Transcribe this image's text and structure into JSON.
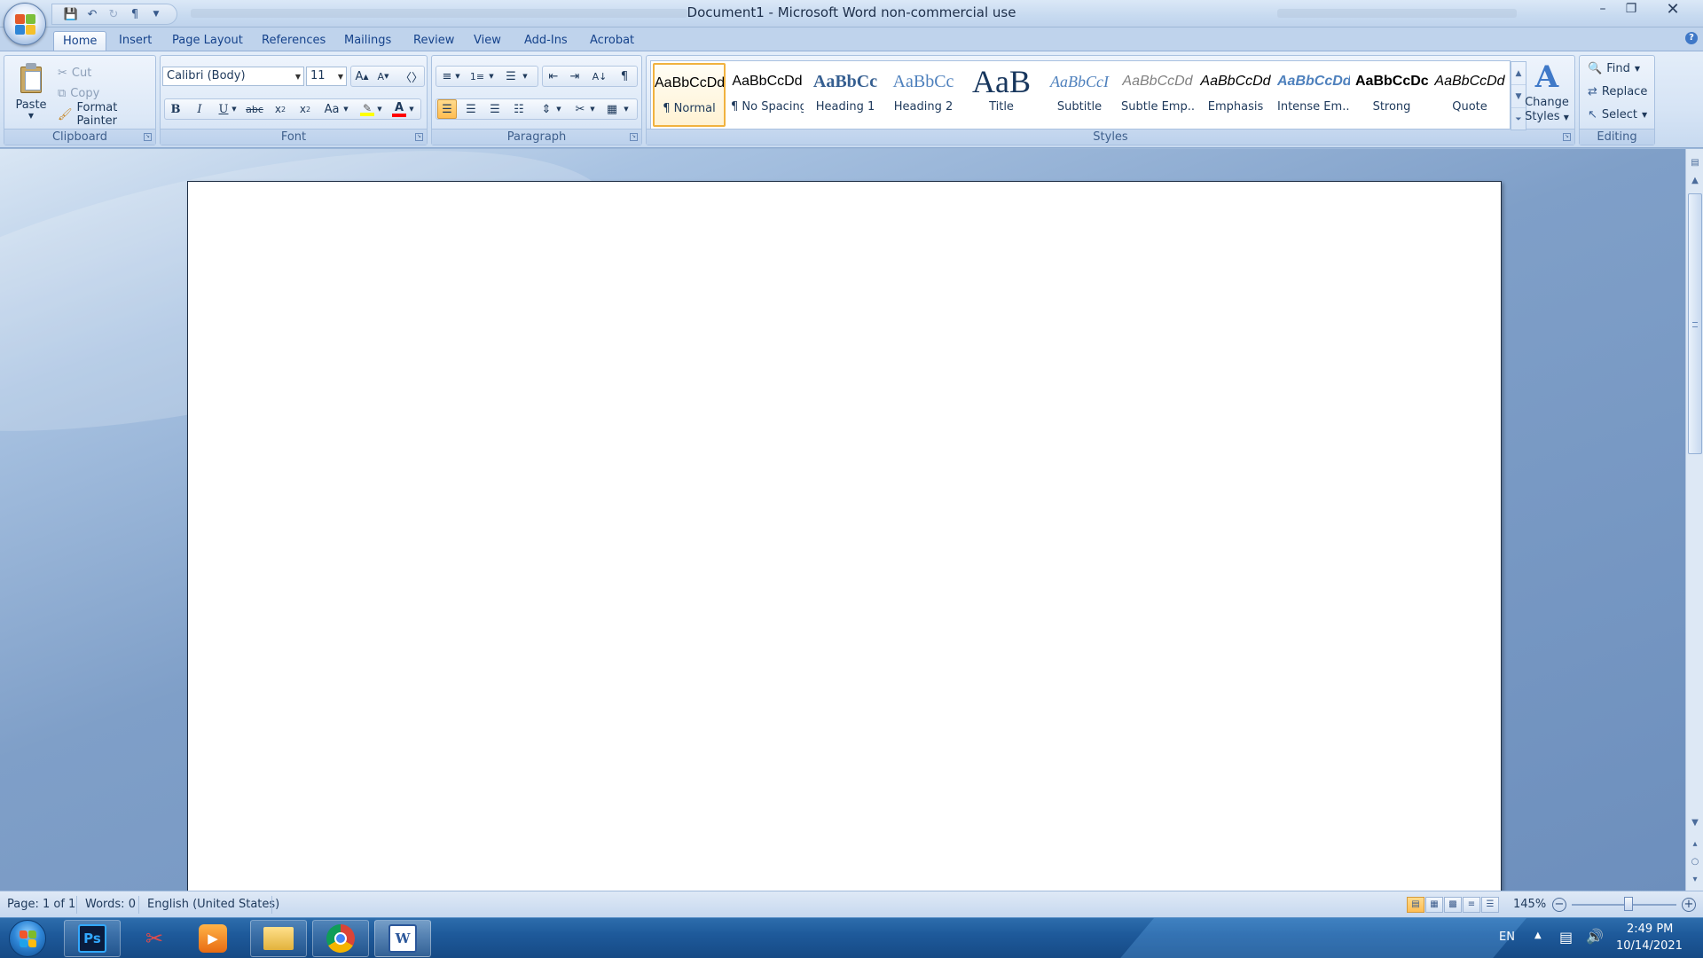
{
  "window": {
    "title": "Document1 - Microsoft Word non-commercial use"
  },
  "quick_access": {
    "items": [
      "save-icon",
      "undo-icon",
      "redo-icon",
      "pilcrow-icon",
      "customize-icon"
    ]
  },
  "tabs": [
    "Home",
    "Insert",
    "Page Layout",
    "References",
    "Mailings",
    "Review",
    "View",
    "Add-Ins",
    "Acrobat"
  ],
  "active_tab": "Home",
  "clipboard": {
    "label": "Clipboard",
    "paste": "Paste",
    "cut": "Cut",
    "copy": "Copy",
    "format_painter": "Format Painter"
  },
  "font": {
    "label": "Font",
    "family": "Calibri (Body)",
    "size": "11",
    "bold": "B",
    "italic": "I",
    "underline": "U",
    "strikethrough": "abc",
    "change_case": "Aa",
    "font_color": "A",
    "font_color_hex": "#ff0000",
    "highlight_hex": "#ffff00"
  },
  "paragraph": {
    "label": "Paragraph",
    "show_marks": "¶"
  },
  "styles": {
    "label": "Styles",
    "items": [
      {
        "sample": "AaBbCcDd",
        "name": "¶ Normal"
      },
      {
        "sample": "AaBbCcDd",
        "name": "¶ No Spacing"
      },
      {
        "sample": "AaBbCc",
        "name": "Heading 1"
      },
      {
        "sample": "AaBbCc",
        "name": "Heading 2"
      },
      {
        "sample": "AaB",
        "name": "Title"
      },
      {
        "sample": "AaBbCcI",
        "name": "Subtitle"
      },
      {
        "sample": "AaBbCcDd",
        "name": "Subtle Emp..."
      },
      {
        "sample": "AaBbCcDd",
        "name": "Emphasis"
      },
      {
        "sample": "AaBbCcDd",
        "name": "Intense Em..."
      },
      {
        "sample": "AaBbCcDc",
        "name": "Strong"
      },
      {
        "sample": "AaBbCcDd",
        "name": "Quote"
      }
    ],
    "selected_index": 0,
    "change_styles_line1": "Change",
    "change_styles_line2": "Styles"
  },
  "editing": {
    "label": "Editing",
    "find": "Find",
    "replace": "Replace",
    "select": "Select"
  },
  "status": {
    "page": "Page: 1 of 1",
    "words": "Words: 0",
    "language": "English (United States)",
    "zoom": "145%"
  },
  "taskbar": {
    "apps": [
      "Photoshop",
      "Snipping Tool",
      "Media Player",
      "File Explorer",
      "Chrome",
      "Word"
    ],
    "language": "EN",
    "time": "2:49 PM",
    "date": "10/14/2021"
  },
  "colors": {
    "ribbon_bg": "#d6e4f5",
    "accent": "#15428b",
    "selected_style": "#f1b23f",
    "taskbar": "#1e5a9b"
  }
}
